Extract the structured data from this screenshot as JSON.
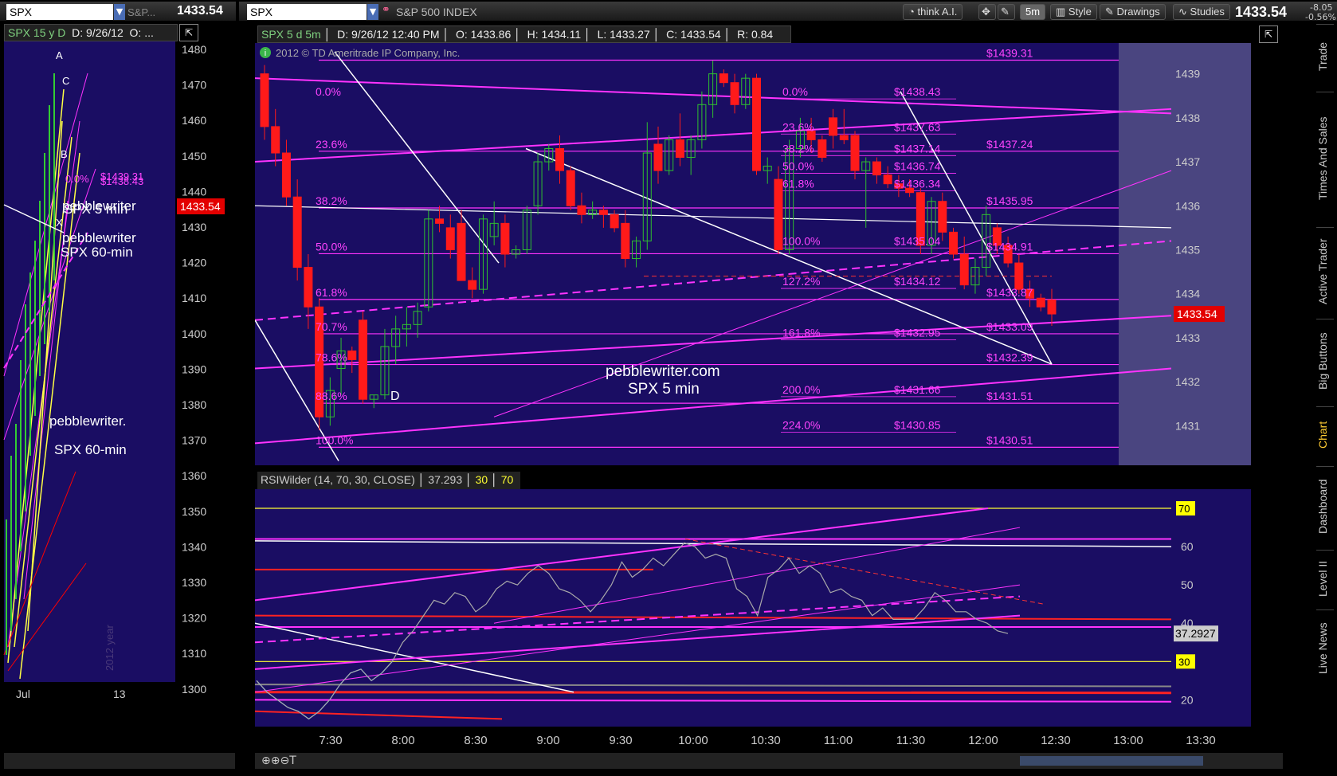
{
  "left_panel": {
    "symbol": "SPX",
    "symbol_desc": "S&P...",
    "last_price": "1433.54",
    "info": "SPX 15 y D",
    "info_date": "D: 9/26/12",
    "info_open": "O: ...",
    "price_label": "1433.54",
    "y_ticks": [
      "1480",
      "1470",
      "1460",
      "1450",
      "1440",
      "1430",
      "1420",
      "1410",
      "1400",
      "1390",
      "1380",
      "1370",
      "1360",
      "1350",
      "1340",
      "1330",
      "1320",
      "1310",
      "1300"
    ],
    "x_ticks": [
      "Jul",
      "13"
    ],
    "watermark": "2012 year",
    "annotations": {
      "a": "A",
      "c": "C",
      "b": "B",
      "x": "X",
      "fib0": "0.0%",
      "p1": "$1439.31",
      "p2": "$1438.43",
      "text1": "pebblewriter",
      "text2": "SPX 5 min",
      "text3": "pebblewriter",
      "text4": "SPX 60-min",
      "text5": "pebblewriter.",
      "text6": "SPX 60-min"
    }
  },
  "toolbar": {
    "symbol": "SPX",
    "description": "S&P 500 INDEX",
    "think_ai": "think A.I.",
    "timeframe": "5m",
    "style": "Style",
    "drawings": "Drawings",
    "studies": "Studies",
    "last_price": "1433.54",
    "change": "-8.05",
    "change_pct": "-0.56%"
  },
  "chart_info": {
    "symbol": "SPX 5 d 5m",
    "date": "D: 9/26/12 12:40 PM",
    "open": "O: 1433.86",
    "high": "H: 1434.11",
    "low": "L: 1433.27",
    "close": "C: 1433.54",
    "range": "R: 0.84",
    "copyright": "2012 © TD Ameritrade IP Company, Inc.",
    "watermark_1": "pebblewriter.com",
    "watermark_2": "SPX 5 min",
    "label_d": "D"
  },
  "rsi_info": {
    "label": "RSIWilder (14, 70, 30, CLOSE)",
    "value": "37.293",
    "os": "30",
    "ob": "70",
    "value_label": "37.2927",
    "tag70": "70",
    "tag30": "30"
  },
  "side_buttons": [
    "Trade",
    "Times And Sales",
    "Active Trader",
    "Big Buttons",
    "Chart",
    "Dashboard",
    "Level II",
    "Live News"
  ],
  "colors": {
    "bg": "#1a0d63",
    "up": "#2fbf2f",
    "down": "#ff1a1a",
    "fib": "#ff33ff",
    "trend": "#ffffff",
    "price_tag": "#e30000"
  },
  "chart_data": {
    "type": "candlestick",
    "x_ticks": [
      "7:30",
      "8:00",
      "8:30",
      "9:00",
      "9:30",
      "10:00",
      "10:30",
      "11:00",
      "11:30",
      "12:00",
      "12:30",
      "13:00",
      "13:30"
    ],
    "y_ticks": [
      "1439",
      "1438",
      "1437",
      "1436",
      "1435",
      "1434",
      "1433",
      "1432",
      "1431"
    ],
    "ylim": [
      1430.1,
      1439.7
    ],
    "price_tag": "1433.54",
    "candles": [
      [
        1439.0,
        1439.2,
        1437.5,
        1437.8
      ],
      [
        1437.8,
        1438.2,
        1436.9,
        1437.2
      ],
      [
        1437.2,
        1437.5,
        1436.0,
        1436.2
      ],
      [
        1436.2,
        1436.6,
        1434.3,
        1434.6
      ],
      [
        1434.6,
        1434.9,
        1433.2,
        1433.7
      ],
      [
        1433.7,
        1433.9,
        1430.9,
        1431.2
      ],
      [
        1431.2,
        1432.1,
        1431.0,
        1431.8
      ],
      [
        1432.3,
        1433.0,
        1431.7,
        1432.7
      ],
      [
        1432.7,
        1432.8,
        1432.2,
        1432.5
      ],
      [
        1433.4,
        1433.6,
        1431.5,
        1431.6
      ],
      [
        1431.6,
        1431.7,
        1431.4,
        1431.7
      ],
      [
        1431.7,
        1433.2,
        1431.6,
        1432.8
      ],
      [
        1432.8,
        1433.5,
        1432.4,
        1433.2
      ],
      [
        1433.2,
        1433.7,
        1432.8,
        1433.3
      ],
      [
        1433.3,
        1433.8,
        1433.0,
        1433.6
      ],
      [
        1433.7,
        1435.9,
        1433.6,
        1435.7
      ],
      [
        1435.7,
        1436.0,
        1435.4,
        1435.6
      ],
      [
        1435.5,
        1435.8,
        1434.8,
        1435.0
      ],
      [
        1435.6,
        1435.9,
        1434.3,
        1434.3
      ],
      [
        1434.3,
        1434.6,
        1433.9,
        1434.1
      ],
      [
        1434.1,
        1435.8,
        1434.0,
        1435.7
      ],
      [
        1435.3,
        1436.1,
        1435.1,
        1435.6
      ],
      [
        1435.6,
        1435.8,
        1434.6,
        1434.9
      ],
      [
        1434.9,
        1435.1,
        1434.8,
        1435.0
      ],
      [
        1435.0,
        1436.0,
        1434.9,
        1435.9
      ],
      [
        1436.0,
        1437.2,
        1435.8,
        1437.0
      ],
      [
        1437.0,
        1437.4,
        1436.8,
        1437.3
      ],
      [
        1437.3,
        1437.6,
        1436.5,
        1436.8
      ],
      [
        1436.8,
        1436.9,
        1435.9,
        1436.0
      ],
      [
        1436.0,
        1436.3,
        1435.6,
        1435.8
      ],
      [
        1435.8,
        1436.1,
        1435.7,
        1435.9
      ],
      [
        1435.9,
        1436.0,
        1435.5,
        1435.8
      ],
      [
        1435.8,
        1435.9,
        1435.4,
        1435.5
      ],
      [
        1435.6,
        1435.9,
        1434.6,
        1434.8
      ],
      [
        1434.8,
        1435.3,
        1434.6,
        1435.2
      ],
      [
        1435.2,
        1437.9,
        1435.0,
        1437.2
      ],
      [
        1437.4,
        1437.8,
        1436.5,
        1436.8
      ],
      [
        1436.8,
        1437.6,
        1436.7,
        1437.5
      ],
      [
        1437.5,
        1438.1,
        1436.9,
        1437.1
      ],
      [
        1437.1,
        1437.6,
        1436.7,
        1437.5
      ],
      [
        1437.5,
        1438.6,
        1437.3,
        1438.3
      ],
      [
        1438.3,
        1439.3,
        1438.0,
        1439.0
      ],
      [
        1439.0,
        1439.1,
        1438.7,
        1438.8
      ],
      [
        1438.8,
        1439.0,
        1438.1,
        1438.3
      ],
      [
        1438.3,
        1439.0,
        1438.2,
        1438.9
      ],
      [
        1438.9,
        1439.0,
        1436.7,
        1436.8
      ],
      [
        1436.8,
        1437.1,
        1436.5,
        1436.9
      ],
      [
        1436.6,
        1436.9,
        1434.9,
        1435.0
      ],
      [
        1435.0,
        1437.5,
        1434.9,
        1437.3
      ],
      [
        1437.3,
        1438.0,
        1437.1,
        1437.7
      ],
      [
        1437.7,
        1438.0,
        1437.2,
        1437.5
      ],
      [
        1437.5,
        1437.6,
        1437.0,
        1437.1
      ],
      [
        1438.0,
        1438.2,
        1437.3,
        1437.6
      ],
      [
        1437.6,
        1438.2,
        1437.4,
        1437.5
      ],
      [
        1437.6,
        1437.7,
        1436.6,
        1436.8
      ],
      [
        1436.8,
        1437.1,
        1435.5,
        1437.0
      ],
      [
        1437.0,
        1437.1,
        1436.5,
        1436.7
      ],
      [
        1436.7,
        1436.9,
        1436.4,
        1436.5
      ],
      [
        1436.5,
        1436.7,
        1436.2,
        1436.4
      ],
      [
        1436.4,
        1436.6,
        1436.2,
        1436.3
      ],
      [
        1436.3,
        1436.4,
        1434.9,
        1435.1
      ],
      [
        1435.1,
        1436.2,
        1434.9,
        1436.1
      ],
      [
        1436.1,
        1436.3,
        1435.2,
        1435.4
      ],
      [
        1435.4,
        1435.5,
        1434.8,
        1434.9
      ],
      [
        1434.9,
        1435.3,
        1434.1,
        1434.2
      ],
      [
        1434.2,
        1434.8,
        1434.0,
        1434.6
      ],
      [
        1434.6,
        1436.0,
        1434.4,
        1435.8
      ],
      [
        1435.5,
        1435.6,
        1434.9,
        1435.1
      ],
      [
        1435.1,
        1435.3,
        1434.6,
        1434.7
      ],
      [
        1434.7,
        1434.9,
        1434.0,
        1434.1
      ],
      [
        1434.1,
        1434.3,
        1433.7,
        1433.9
      ],
      [
        1433.9,
        1434.0,
        1433.6,
        1433.7
      ],
      [
        1433.86,
        1434.11,
        1433.27,
        1433.54
      ]
    ],
    "fib_left": [
      {
        "label": "0.0%",
        "price": 1438.43
      },
      {
        "label": "23.6%",
        "price": 1437.24
      },
      {
        "label": "38.2%",
        "price": 1435.95
      },
      {
        "label": "50.0%",
        "price": 1434.91
      },
      {
        "label": "61.8%",
        "price": 1433.87
      },
      {
        "label": "70.7%",
        "price": 1433.09
      },
      {
        "label": "78.6%",
        "price": 1432.39
      },
      {
        "label": "88.6%",
        "price": 1431.51
      },
      {
        "label": "100.0%",
        "price": 1430.51
      }
    ],
    "fib_right_prices": [
      "$1439.31",
      "$1437.24",
      "$1435.95",
      "$1434.91",
      "$1433.87",
      "$1433.09",
      "$1432.39",
      "$1431.51",
      "$1430.51"
    ],
    "fib_right_values": [
      1439.31,
      1437.24,
      1435.95,
      1434.91,
      1433.87,
      1433.09,
      1432.39,
      1431.51,
      1430.51
    ],
    "fib_mid": [
      {
        "label": "0.0%",
        "price_label": "$1438.43",
        "price": 1438.43
      },
      {
        "label": "23.6%",
        "price_label": "$1437.63",
        "price": 1437.63
      },
      {
        "label": "38.2%",
        "price_label": "$1437.14",
        "price": 1437.14
      },
      {
        "label": "50.0%",
        "price_label": "$1436.74",
        "price": 1436.74
      },
      {
        "label": "61.8%",
        "price_label": "$1436.34",
        "price": 1436.34
      },
      {
        "label": "100.0%",
        "price_label": "$1435.04",
        "price": 1435.04
      },
      {
        "label": "127.2%",
        "price_label": "$1434.12",
        "price": 1434.12
      },
      {
        "label": "161.8%",
        "price_label": "$1432.95",
        "price": 1432.95
      },
      {
        "label": "200.0%",
        "price_label": "$1431.66",
        "price": 1431.66
      },
      {
        "label": "224.0%",
        "price_label": "$1430.85",
        "price": 1430.85
      }
    ],
    "rsi": {
      "y_ticks": [
        "70",
        "60",
        "50",
        "40",
        "30",
        "20"
      ],
      "ylim": [
        13,
        75
      ],
      "values": [
        25,
        22,
        20,
        18,
        17,
        15,
        17,
        20,
        24,
        27,
        28,
        25,
        27,
        30,
        35,
        38,
        42,
        46,
        45,
        48,
        47,
        43,
        45,
        49,
        51,
        50,
        53,
        55,
        53,
        49,
        48,
        46,
        43,
        46,
        50,
        56,
        52,
        54,
        57,
        55,
        58,
        61,
        60,
        57,
        58,
        57,
        49,
        47,
        42,
        52,
        54,
        57,
        53,
        55,
        53,
        48,
        49,
        47,
        46,
        42,
        44,
        41,
        41,
        41,
        44,
        48,
        46,
        43,
        43,
        41,
        40,
        38,
        37.3
      ]
    }
  }
}
